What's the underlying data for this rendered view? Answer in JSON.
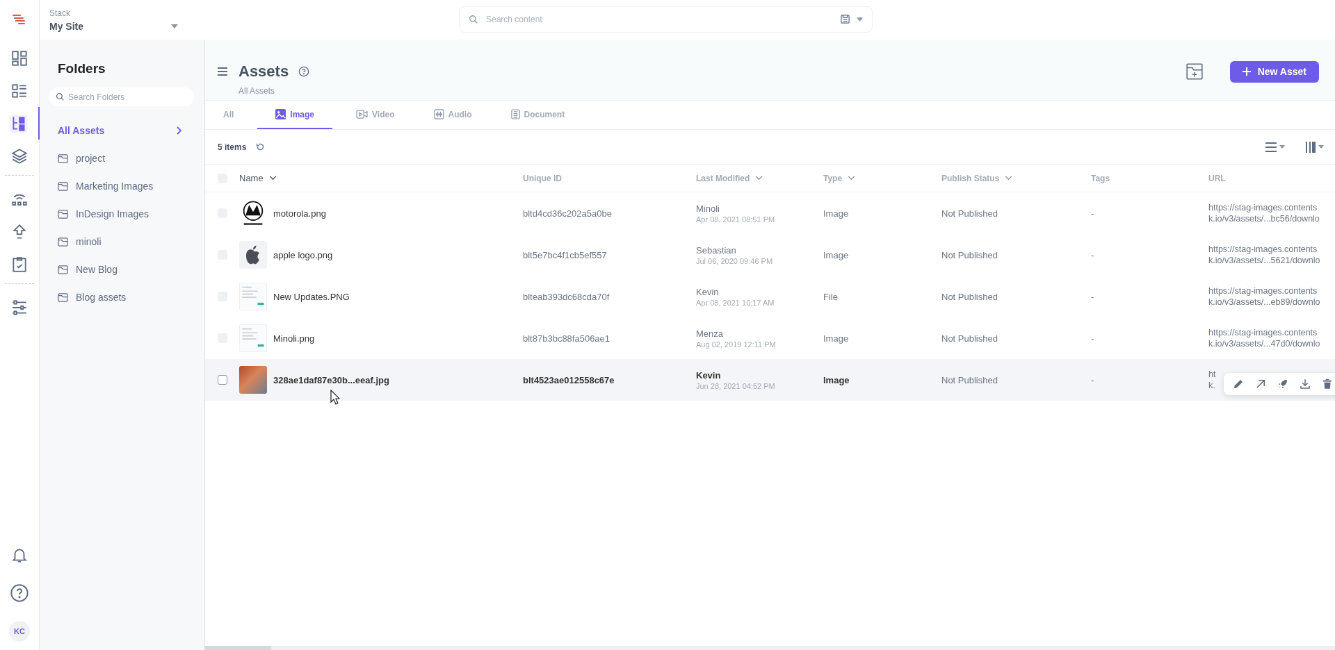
{
  "topbar": {
    "stack_label": "Stack",
    "stack_name": "My Site",
    "search": {
      "placeholder": "Search content"
    }
  },
  "rail": {
    "groups": [
      [
        {
          "kind": "dashboard",
          "selected": false
        },
        {
          "kind": "list",
          "selected": false
        },
        {
          "kind": "tree",
          "selected": true
        },
        {
          "kind": "layers",
          "selected": false
        }
      ],
      [
        {
          "kind": "network",
          "selected": false
        },
        {
          "kind": "upload",
          "selected": false
        },
        {
          "kind": "clipboard",
          "selected": false
        }
      ],
      [
        {
          "kind": "sliders",
          "selected": false
        }
      ]
    ],
    "avatar": "KC"
  },
  "folders": {
    "title": "Folders",
    "search": {
      "placeholder": "Search Folders"
    },
    "items": [
      {
        "label": "All Assets",
        "kind": "root",
        "selected": true
      },
      {
        "label": "project",
        "kind": "folder",
        "selected": false
      },
      {
        "label": "Marketing Images",
        "kind": "folder",
        "selected": false
      },
      {
        "label": "InDesign Images",
        "kind": "folder",
        "selected": false
      },
      {
        "label": "minoli",
        "kind": "folder",
        "selected": false
      },
      {
        "label": "New Blog",
        "kind": "folder",
        "selected": false
      },
      {
        "label": "Blog assets",
        "kind": "folder",
        "selected": false
      }
    ]
  },
  "header": {
    "title": "Assets",
    "subtitle": "All Assets",
    "new_button": "New Asset"
  },
  "tabs": [
    {
      "label": "All",
      "kind": "all",
      "selected": false
    },
    {
      "label": "Image",
      "kind": "image",
      "selected": true
    },
    {
      "label": "Video",
      "kind": "video",
      "selected": false
    },
    {
      "label": "Audio",
      "kind": "audio",
      "selected": false
    },
    {
      "label": "Document",
      "kind": "document",
      "selected": false
    }
  ],
  "count": "5 items",
  "table": {
    "select_all": {
      "checked": false
    },
    "columns": [
      {
        "label": "Name",
        "sortable": true
      },
      {
        "label": "Unique ID",
        "sortable": false
      },
      {
        "label": "Last Modified",
        "sortable": true
      },
      {
        "label": "Type",
        "sortable": true
      },
      {
        "label": "Publish Status",
        "sortable": true
      },
      {
        "label": "Tags",
        "sortable": false
      },
      {
        "label": "URL",
        "sortable": false
      }
    ],
    "rows": [
      {
        "kind": "logo",
        "name": "motorola.png",
        "uid": "bltd4cd36c202a5a0be",
        "user": "Minoli",
        "date": "Apr 08, 2021 08:51 PM",
        "type": "Image",
        "status": "Not Published",
        "tags": "-",
        "url": [
          "https://stag-images.contents",
          "k.io/v3/assets/...bc56/downlo"
        ],
        "checked": false,
        "hovered": false
      },
      {
        "kind": "apple",
        "name": "apple logo.png",
        "uid": "blt5e7bc4f1cb5ef557",
        "user": "Sebastian",
        "date": "Jul 06, 2020 09:46 PM",
        "type": "Image",
        "status": "Not Published",
        "tags": "-",
        "url": [
          "https://stag-images.contents",
          "k.io/v3/assets/...5621/downlo"
        ],
        "checked": false,
        "hovered": false
      },
      {
        "kind": "screenshot",
        "name": "New Updates.PNG",
        "uid": "blteab393dc68cda70f",
        "user": "Kevin",
        "date": "Apr 08, 2021 10:17 AM",
        "type": "File",
        "status": "Not Published",
        "tags": "-",
        "url": [
          "https://stag-images.contents",
          "k.io/v3/assets/...eb89/downlo"
        ],
        "checked": false,
        "hovered": false
      },
      {
        "kind": "screenshot",
        "name": "Minoli.png",
        "uid": "blt87b3bc88fa506ae1",
        "user": "Menza",
        "date": "Aug 02, 2019 12:11 PM",
        "type": "Image",
        "status": "Not Published",
        "tags": "-",
        "url": [
          "https://stag-images.contents",
          "k.io/v3/assets/...47d0/downlo"
        ],
        "checked": false,
        "hovered": false
      },
      {
        "kind": "photo",
        "name": "328ae1daf87e30b...eeaf.jpg",
        "uid": "blt4523ae012558c67e",
        "user": "Kevin",
        "date": "Jun 28, 2021 04:52 PM",
        "type": "Image",
        "status": "Not Published",
        "tags": "-",
        "url": [
          "ht",
          "k."
        ],
        "checked": false,
        "hovered": true
      }
    ]
  }
}
